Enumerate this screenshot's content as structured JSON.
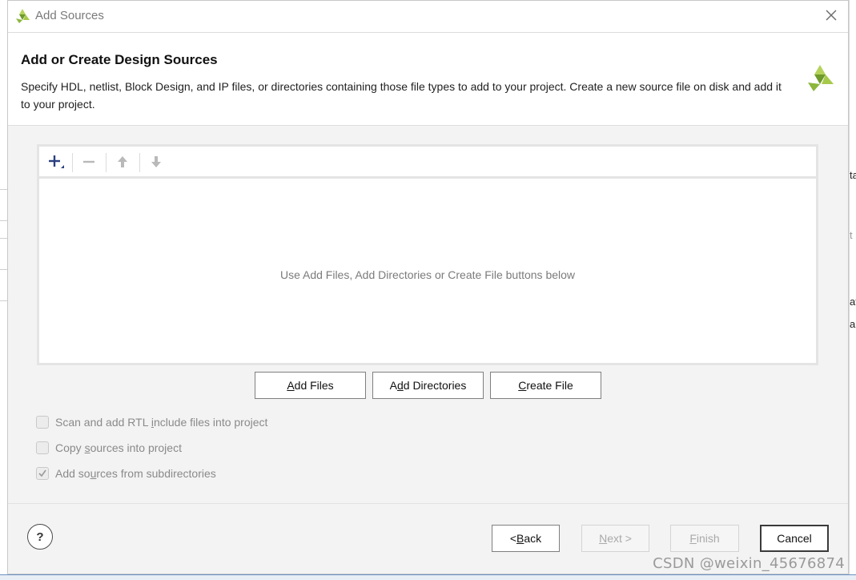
{
  "window": {
    "title": "Add Sources"
  },
  "header": {
    "title": "Add or Create Design Sources",
    "description": "Specify HDL, netlist, Block Design, and IP files, or directories containing those file types to add to your project. Create a new source file on disk and add it to your project."
  },
  "toolbar": {
    "add": "add-icon",
    "remove": "remove-icon",
    "move_up": "arrow-up-icon",
    "move_down": "arrow-down-icon"
  },
  "file_list": {
    "empty_message": "Use Add Files, Add Directories or Create File buttons below"
  },
  "actions": {
    "add_files": {
      "mnemonic": "A",
      "rest": "dd Files"
    },
    "add_directories": {
      "pre": "A",
      "mnemonic": "d",
      "rest": "d Directories"
    },
    "create_file": {
      "mnemonic": "C",
      "rest": "reate File"
    }
  },
  "options": [
    {
      "pre": "Scan and add RTL ",
      "mnemonic": "i",
      "post": "nclude files into project",
      "checked": false,
      "enabled": false
    },
    {
      "pre": "Copy ",
      "mnemonic": "s",
      "post": "ources into project",
      "checked": false,
      "enabled": false
    },
    {
      "pre": "Add so",
      "mnemonic": "u",
      "post": "rces from subdirectories",
      "checked": true,
      "enabled": false
    }
  ],
  "footer": {
    "help": "?",
    "back": {
      "pre": "< ",
      "mnemonic": "B",
      "post": "ack"
    },
    "next": {
      "mnemonic": "N",
      "post": "ext >"
    },
    "finish": {
      "mnemonic": "F",
      "post": "inish"
    },
    "cancel": "Cancel"
  },
  "background": {
    "fragments": [
      "ta",
      "t",
      "at",
      "al"
    ]
  },
  "watermark": "CSDN @weixin_45676874",
  "colors": {
    "logo_green": "#8cb63c",
    "panel_border": "#e4e4e4",
    "toolbar_icon": "#2a3f80"
  }
}
